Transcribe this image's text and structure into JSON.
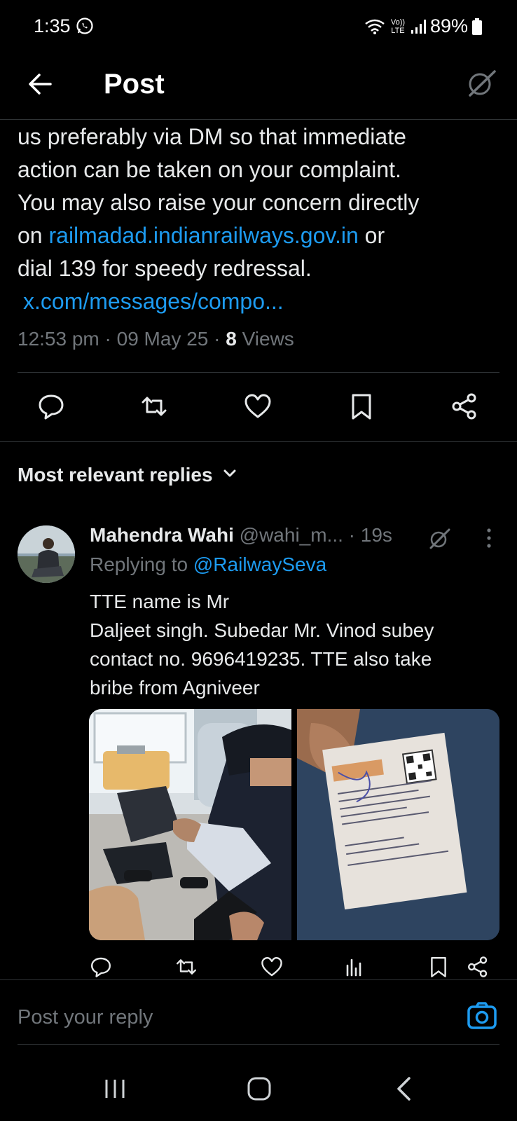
{
  "status_bar": {
    "time": "1:35",
    "battery": "89%",
    "network": "Vo)) LTE"
  },
  "header": {
    "title": "Post",
    "back_icon": "arrow-left-icon",
    "grok_icon": "grok-icon"
  },
  "post": {
    "text_before_link": "us preferably via DM so that immediate\naction can be taken on your complaint.\nYou may also raise your concern directly\non ",
    "inline_link": "railmadad.indianrailways.gov.in",
    "text_after_link": " or\ndial 139 for speedy redressal.",
    "link_line": "x.com/messages/compo...",
    "meta_time": "12:53 pm · 09 May 25 · ",
    "views_count": "8",
    "views_label": " Views"
  },
  "actions": [
    "reply-icon",
    "repost-icon",
    "like-icon",
    "bookmark-icon",
    "share-icon"
  ],
  "replies_section": {
    "label": "Most relevant replies"
  },
  "reply": {
    "name": "Mahendra Wahi",
    "handle": " @wahi_m... · 19s",
    "replying_prefix": "Replying to ",
    "replying_to": "@RailwaySeva",
    "text": "TTE name is Mr\n Daljeet singh. Subedar Mr. Vinod subey\ncontact no. 9696419235. TTE also take\nbribe from Agniveer"
  },
  "reply_actions": [
    "reply-icon",
    "repost-icon",
    "like-icon",
    "views-icon",
    "bookmark-icon",
    "share-icon"
  ],
  "composer": {
    "placeholder": "Post your reply"
  },
  "colors": {
    "background": "#000000",
    "text": "#e7e9ea",
    "secondary": "#71767b",
    "link": "#1d9bf0",
    "border": "#2f3336"
  }
}
